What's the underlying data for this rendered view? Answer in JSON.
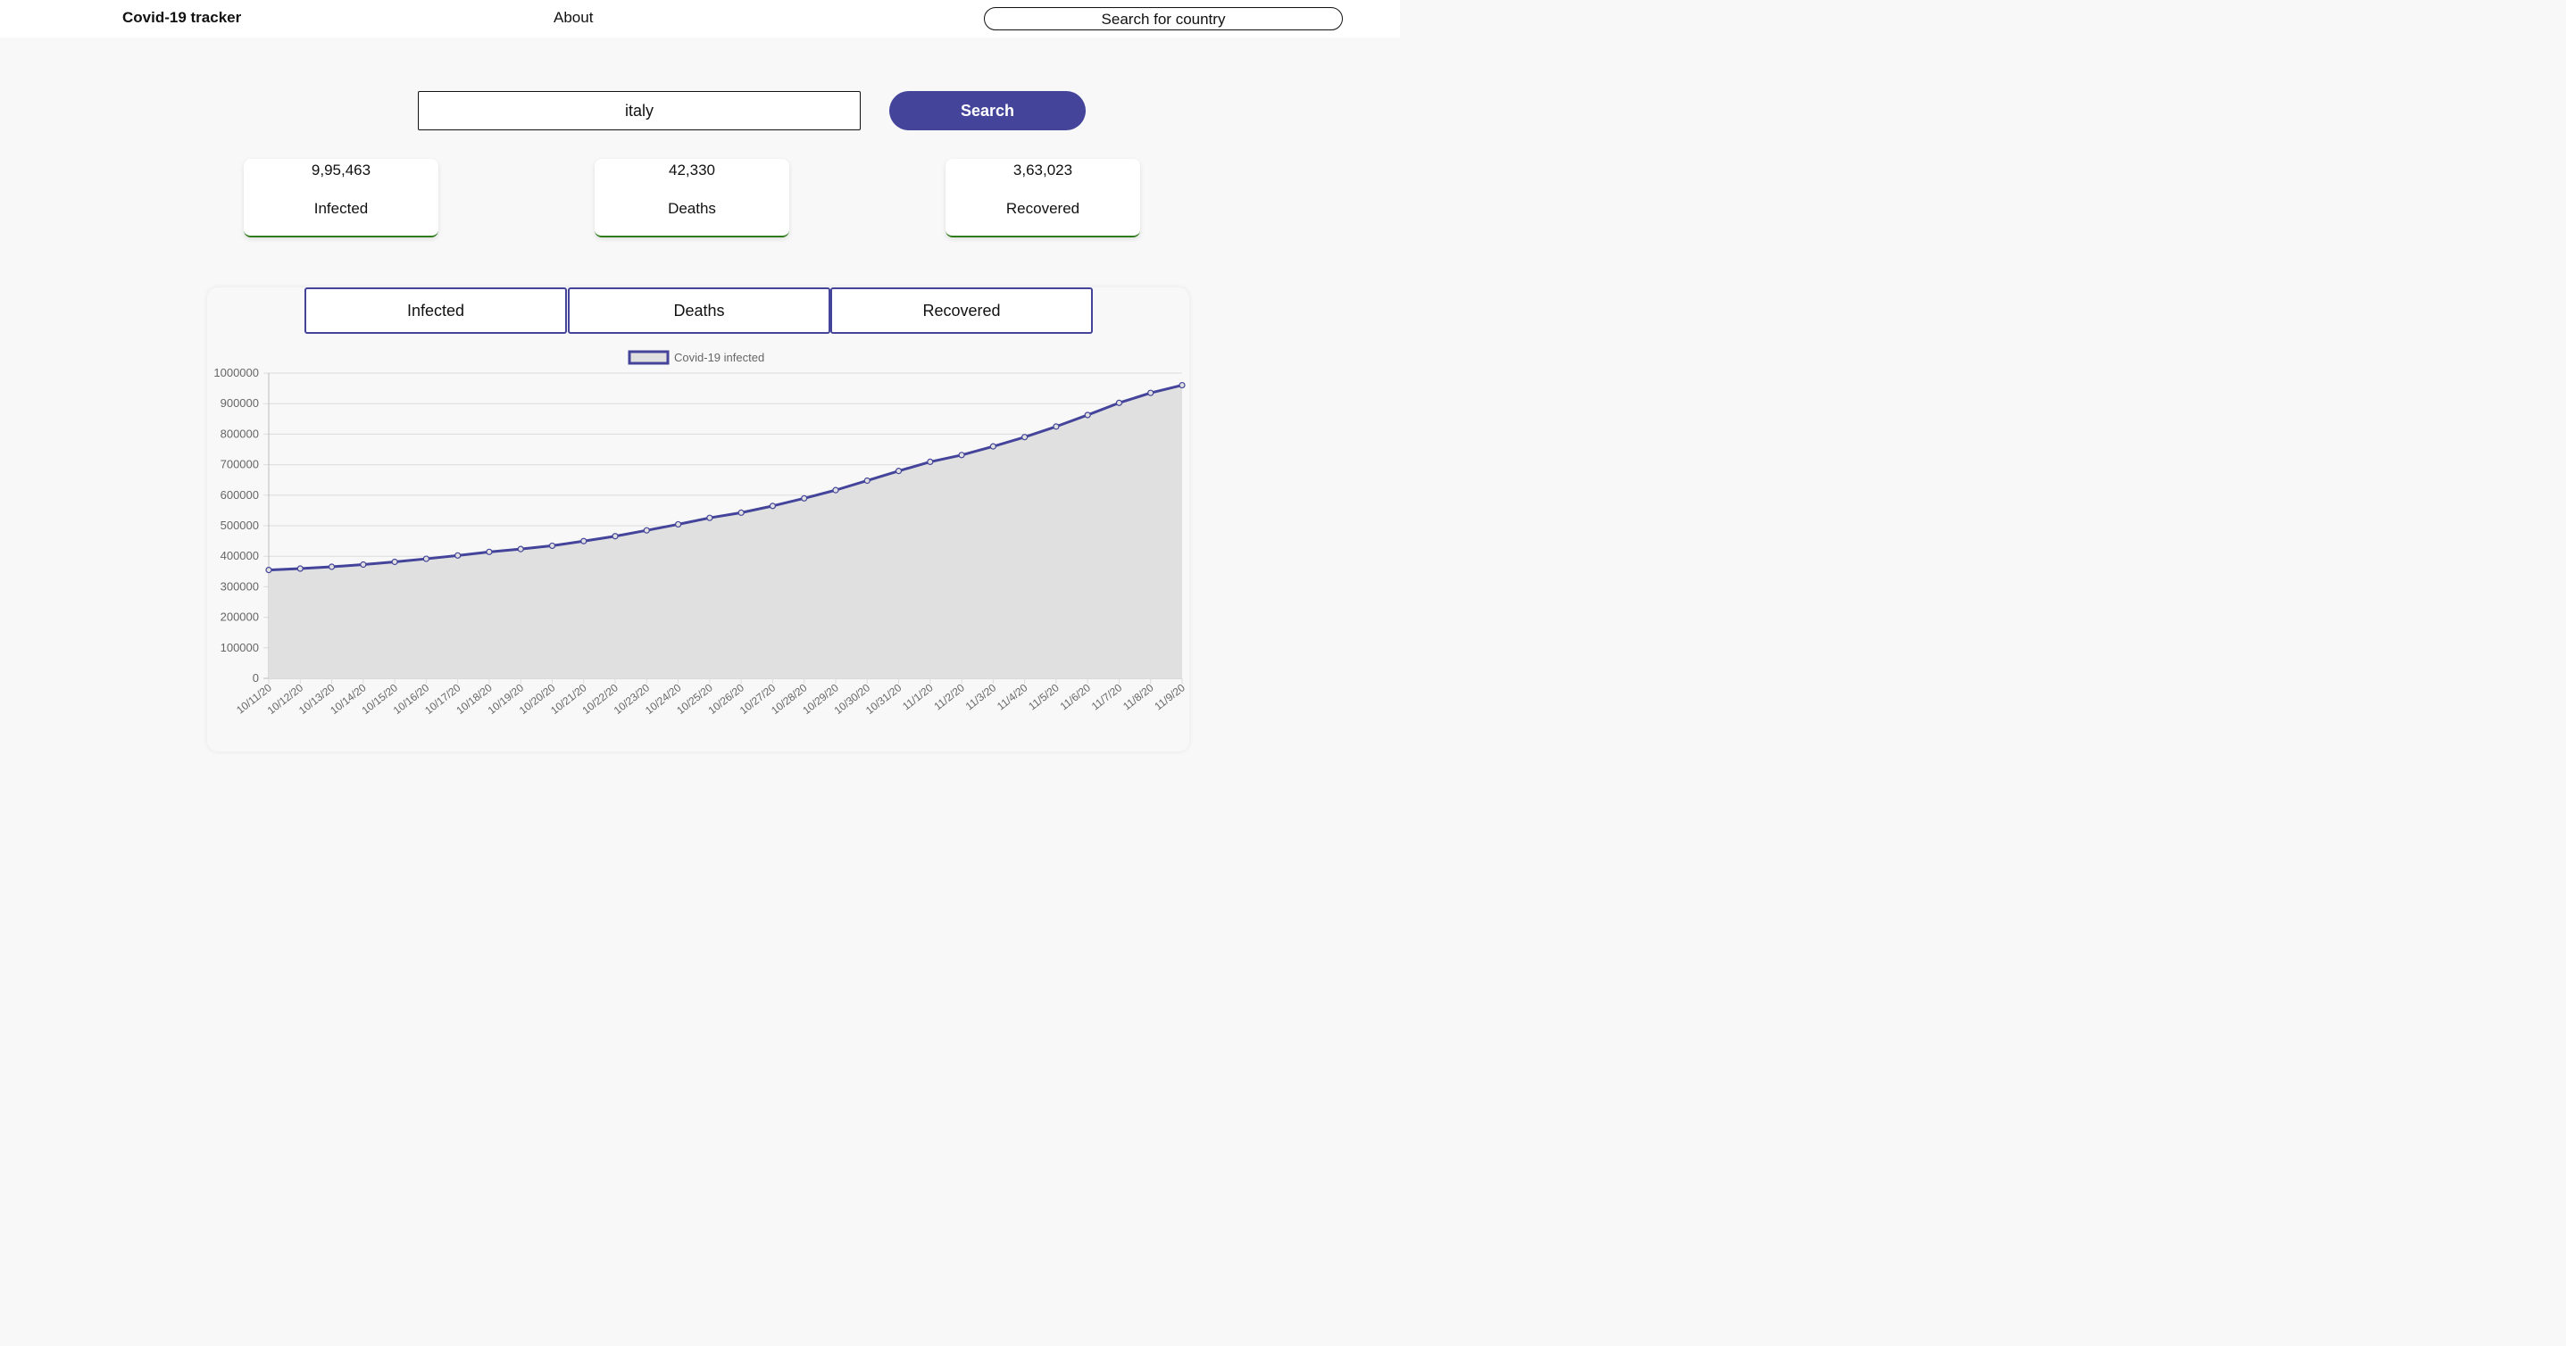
{
  "header": {
    "brand": "Covid-19 tracker",
    "about": "About",
    "search_placeholder": "Search for country"
  },
  "search": {
    "value": "italy",
    "button": "Search"
  },
  "stats": [
    {
      "value": "9,95,463",
      "label": "Infected"
    },
    {
      "value": "42,330",
      "label": "Deaths"
    },
    {
      "value": "3,63,023",
      "label": "Recovered"
    }
  ],
  "tabs": [
    "Infected",
    "Deaths",
    "Recovered"
  ],
  "colors": {
    "accent": "#43449a",
    "card_border": "#2e7d1a",
    "area_fill": "#e0e0e0"
  },
  "chart_data": {
    "type": "area",
    "legend": "Covid-19 infected",
    "ylim": [
      0,
      1000000
    ],
    "yticks": [
      0,
      100000,
      200000,
      300000,
      400000,
      500000,
      600000,
      700000,
      800000,
      900000,
      1000000
    ],
    "grid": true,
    "x": [
      "10/11/20",
      "10/12/20",
      "10/13/20",
      "10/14/20",
      "10/15/20",
      "10/16/20",
      "10/17/20",
      "10/18/20",
      "10/19/20",
      "10/20/20",
      "10/21/20",
      "10/22/20",
      "10/23/20",
      "10/24/20",
      "10/25/20",
      "10/26/20",
      "10/27/20",
      "10/28/20",
      "10/29/20",
      "10/30/20",
      "10/31/20",
      "11/1/20",
      "11/2/20",
      "11/3/20",
      "11/4/20",
      "11/5/20",
      "11/6/20",
      "11/7/20",
      "11/8/20",
      "11/9/20"
    ],
    "series": [
      {
        "name": "Covid-19 infected",
        "values": [
          354950,
          359570,
          365467,
          372799,
          381602,
          391611,
          402536,
          414241,
          423578,
          434449,
          449648,
          465726,
          484869,
          504509,
          525782,
          542789,
          564778,
          589766,
          616595,
          647674,
          679430,
          709335,
          731588,
          759829,
          790377,
          824879,
          862681,
          902490,
          935104,
          960373
        ]
      }
    ]
  }
}
